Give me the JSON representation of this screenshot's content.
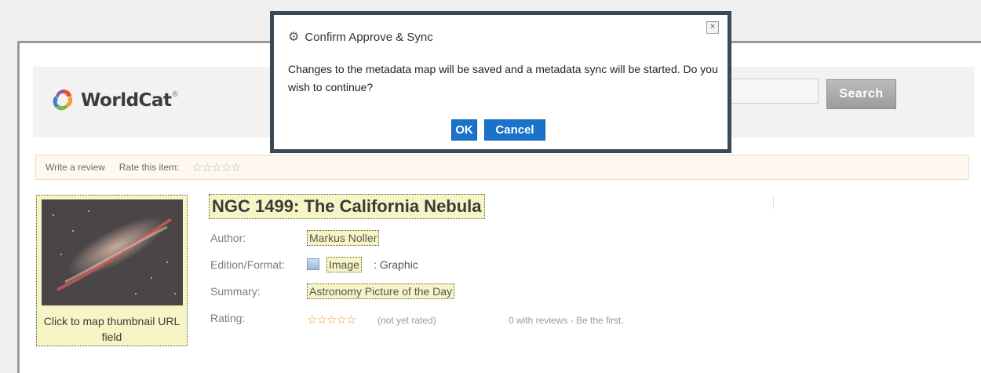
{
  "header": {
    "logo_text": "WorldCat",
    "logo_reg": "®",
    "search_button": "Search"
  },
  "actions": {
    "write_review": "Write a review",
    "rate_item": "Rate this item:",
    "empty_stars": "☆☆☆☆☆"
  },
  "record": {
    "title": "NGC 1499: The California Nebula",
    "thumbnail_caption": "Click to map thumbnail URL field",
    "author_label": "Author:",
    "author_value": "Markus Noller",
    "edition_label": "Edition/Format:",
    "edition_value": "Image",
    "edition_suffix": ": Graphic",
    "summary_label": "Summary:",
    "summary_value": "Astronomy Picture of the Day",
    "rating_label": "Rating:",
    "rating_stars": "☆☆☆☆☆",
    "rating_status": "(not yet rated)",
    "reviews_text": "0 with reviews - Be the first."
  },
  "modal": {
    "title": "Confirm Approve & Sync",
    "message": "Changes to the metadata map will be saved and a metadata sync will be started. Do you wish to continue?",
    "close_label": "×",
    "ok_label": "OK",
    "cancel_label": "Cancel"
  },
  "colors": {
    "modal_border": "#3b4a56",
    "button_blue": "#1a73c9",
    "highlight_yellow": "#f7f5c6",
    "star_orange": "#e89a3c"
  },
  "icons": [
    "worldcat-logo-icon",
    "gear-icon",
    "close-icon",
    "image-format-icon",
    "star-icon"
  ]
}
